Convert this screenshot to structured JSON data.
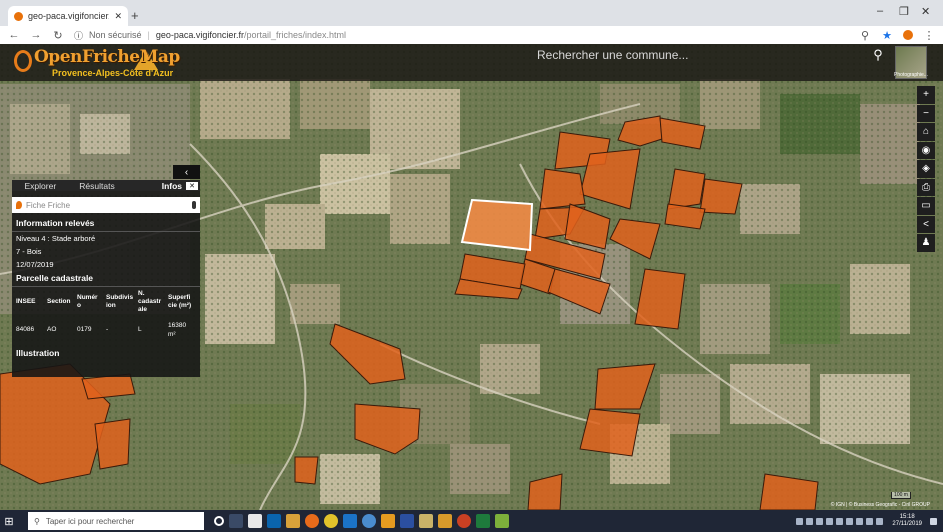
{
  "browser": {
    "tab_title": "geo-paca.vigifoncier.fr/portail_fi",
    "new_tab": "+",
    "security": "Non sécurisé",
    "domain": "geo-paca.vigifoncier.fr",
    "path": "/portail_friches/index.html",
    "win_min": "–",
    "win_max": "❐",
    "win_close": "✕"
  },
  "header": {
    "logo_main": "OpenFricheMap",
    "logo_sub": "Provence-Alpes-Côte d'Azur",
    "search_placeholder": "Rechercher une commune...",
    "search_icon": "search-icon",
    "photo_label": "Photographie..."
  },
  "panel": {
    "tabs": [
      "Explorer",
      "Résultats",
      "Infos"
    ],
    "search_placeholder": "Fiche Friche",
    "section_info": "Information relevés",
    "info_lines": [
      "Niveau 4 : Stade arboré",
      "7 - Bois",
      "12/07/2019"
    ],
    "section_parcelle": "Parcelle cadastrale",
    "columns": [
      "INSEE",
      "Section",
      "Numéro",
      "Subdivision",
      "N. cadastrale",
      "Superficie (m²)"
    ],
    "columns_display": [
      "INSEE",
      "Section",
      "Numér\no",
      "Subdivis\nion",
      "N.\ncadastr\nale",
      "Superfi\ncie (m²)"
    ],
    "row": [
      "84086",
      "AO",
      "0179",
      "-",
      "L",
      "16380\nm²"
    ],
    "section_illustration": "Illustration"
  },
  "map": {
    "scale_label": "100 m",
    "attribution": "© IGN | © Business Geografic - Ciril GROUP",
    "field_color": "#e0621c",
    "selected_color": "#f08a45"
  },
  "taskbar": {
    "search_placeholder": "Taper ici pour rechercher",
    "time": "15:18",
    "date": "27/11/2019"
  }
}
